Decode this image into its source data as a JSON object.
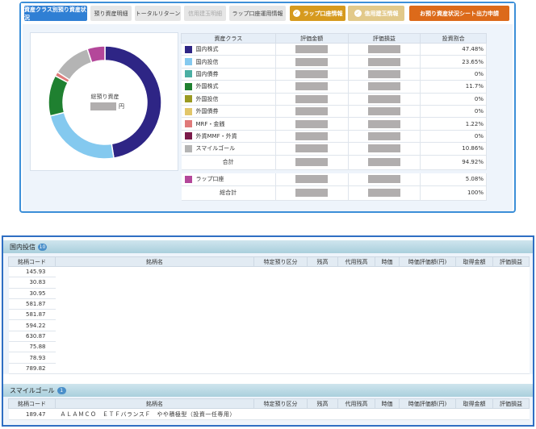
{
  "tabs": [
    {
      "label": "資産クラス別預り資産状況"
    },
    {
      "label": "預り資産明細"
    },
    {
      "label": "トータルリターン"
    },
    {
      "label": "信用建玉明細"
    },
    {
      "label": "ラップ口座運用情報"
    },
    {
      "label": "ラップ口座情報"
    },
    {
      "label": "信用建玉情報"
    },
    {
      "label": "お預り資産状況シート出力申請"
    }
  ],
  "donut": {
    "center_label": "総預り資産",
    "center_unit": "円"
  },
  "alloc_table": {
    "headers": [
      "資産クラス",
      "評価金額",
      "評価損益",
      "投資割合"
    ],
    "rows": [
      {
        "name": "国内株式",
        "color": "#2e2585",
        "pct": "47.48%"
      },
      {
        "name": "国内投信",
        "color": "#84c9ef",
        "pct": "23.65%"
      },
      {
        "name": "国内債券",
        "color": "#4aafa3",
        "pct": "0%"
      },
      {
        "name": "外国株式",
        "color": "#1f8030",
        "pct": "11.7%"
      },
      {
        "name": "外国投信",
        "color": "#9a9a22",
        "pct": "0%"
      },
      {
        "name": "外国債券",
        "color": "#e2c66a",
        "pct": "0%"
      },
      {
        "name": "MRF・金銭",
        "color": "#e07a7a",
        "pct": "1.22%"
      },
      {
        "name": "外貨MMF・外貨",
        "color": "#7a1a4a",
        "pct": "0%"
      },
      {
        "name": "スマイルゴール",
        "color": "#b4b4b4",
        "pct": "10.86%"
      }
    ],
    "subtotal": {
      "label": "合計",
      "pct": "94.92%"
    },
    "wrap": {
      "name": "ラップ口座",
      "color": "#b4479a",
      "pct": "5.08%"
    },
    "total": {
      "label": "総合計",
      "pct": "100%"
    }
  },
  "chart_data": {
    "type": "pie",
    "categories": [
      "国内株式",
      "国内投信",
      "国内債券",
      "外国株式",
      "外国投信",
      "外国債券",
      "MRF・金銭",
      "外貨MMF・外貨",
      "スマイルゴール",
      "ラップ口座"
    ],
    "values": [
      47.48,
      23.65,
      0,
      11.7,
      0,
      0,
      1.22,
      0,
      10.86,
      5.08
    ],
    "colors": [
      "#2e2585",
      "#84c9ef",
      "#4aafa3",
      "#1f8030",
      "#9a9a22",
      "#e2c66a",
      "#e07a7a",
      "#7a1a4a",
      "#b4b4b4",
      "#b4479a"
    ]
  },
  "holdings_domestic_funds": {
    "title": "国内投信",
    "count": "10",
    "headers": [
      "銘柄コード",
      "銘柄名",
      "特定預り区分",
      "残高",
      "代用残高",
      "時価",
      "時価評価額(円)",
      "取得金額",
      "評価損益"
    ],
    "codes": [
      "145.93",
      "30.83",
      "30.95",
      "581.87",
      "581.87",
      "594.22",
      "630.87",
      "75.88",
      "78.93",
      "789.82"
    ]
  },
  "holdings_smile_goal": {
    "title": "スマイルゴール",
    "count": "1",
    "headers": [
      "銘柄コード",
      "銘柄名",
      "特定預り区分",
      "残高",
      "代用残高",
      "時価",
      "時価評価額(円)",
      "取得金額",
      "評価損益"
    ],
    "row": {
      "code": "189.47",
      "name": "ＡＬＡＭＣＯ　ＥＴＦバランスＦ　やや積極型（投資一任専用）"
    }
  }
}
